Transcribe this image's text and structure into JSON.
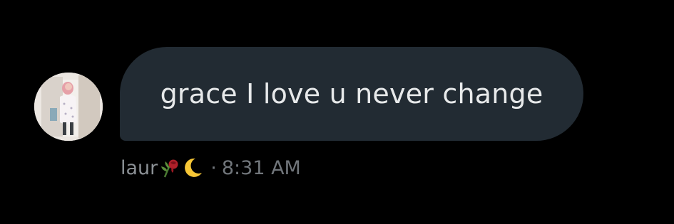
{
  "message": {
    "text": "grace I love u never change",
    "sender_name": "laur",
    "sender_emojis": [
      "wilted-rose-icon",
      "crescent-moon-icon"
    ],
    "separator": "·",
    "timestamp": "8:31 AM"
  },
  "colors": {
    "background": "#000000",
    "bubble": "#222b33",
    "bubble_text": "#e7e9ea",
    "meta_text": "#71767b"
  }
}
